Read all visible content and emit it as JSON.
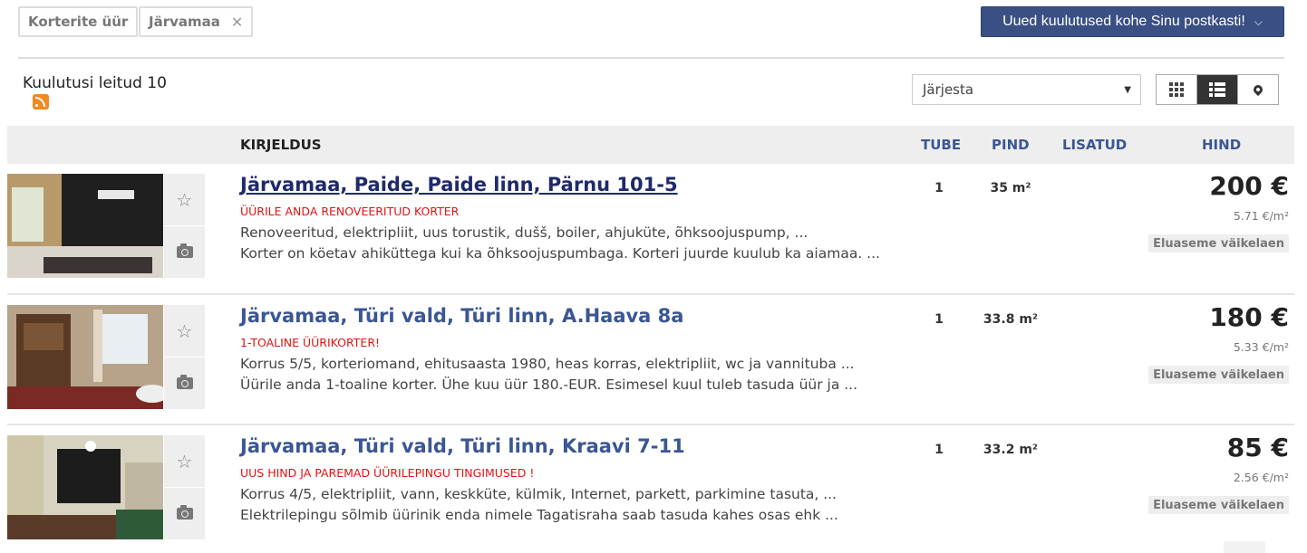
{
  "filters": {
    "chip1": "Korterite üür",
    "chip2": "Järvamaa",
    "chip2_remove": "✕"
  },
  "subscribe": {
    "label": "Uued kuulutused kohe Sinu postkasti!",
    "chevron": "⌵"
  },
  "results": {
    "count_text": "Kuulutusi leitud 10"
  },
  "sort": {
    "label": "Järjesta",
    "caret": "▼"
  },
  "table_header": {
    "kirjeldus": "KIRJELDUS",
    "tube": "TUBE",
    "pind": "PIND",
    "lisatud": "LISATUD",
    "hind": "HIND"
  },
  "icons": {
    "favorite": "☆"
  },
  "listings": [
    {
      "title": "Järvamaa, Paide, Paide linn, Pärnu 101-5",
      "slogan": "ÜÜRILE ANDA RENOVEERITUD KORTER",
      "desc1": "Renoveeritud, elektripliit, uus torustik, dušš, boiler, ahjuküte, õhksoojuspump, ...",
      "desc2": "Korter on köetav ahiküttega kui ka õhksoojuspumbaga. Korteri juurde kuulub ka aiamaa. ...",
      "rooms": "1",
      "area": "35 m²",
      "price": "200 €",
      "price_per_m2": "5.71 €/m²",
      "badge": "Eluaseme väikelaen"
    },
    {
      "title": "Järvamaa, Türi vald, Türi linn, A.Haava 8a",
      "slogan": "1-TOALINE ÜÜRIKORTER!",
      "desc1": "Korrus 5/5, korteriomand, ehitusaasta 1980, heas korras, elektripliit, wc ja vannituba ...",
      "desc2": "Üürile anda 1-toaline korter. Ühe kuu üür 180.-EUR. Esimesel kuul tuleb tasuda üür ja ...",
      "rooms": "1",
      "area": "33.8 m²",
      "price": "180 €",
      "price_per_m2": "5.33 €/m²",
      "badge": "Eluaseme väikelaen"
    },
    {
      "title": "Järvamaa, Türi vald, Türi linn, Kraavi 7-11",
      "slogan": "UUS HIND JA PAREMAD ÜÜRILEPINGU TINGIMUSED !",
      "desc1": "Korrus 4/5, elektripliit, vann, keskküte, külmik, Internet, parkett, parkimine tasuta, ...",
      "desc2": "Elektrilepingu sõlmib üürinik enda nimele Tagatisraha saab tasuda kahes osas ehk ...",
      "rooms": "1",
      "area": "33.2 m²",
      "price": "85 €",
      "price_per_m2": "2.56 €/m²",
      "badge": "Eluaseme väikelaen"
    }
  ]
}
